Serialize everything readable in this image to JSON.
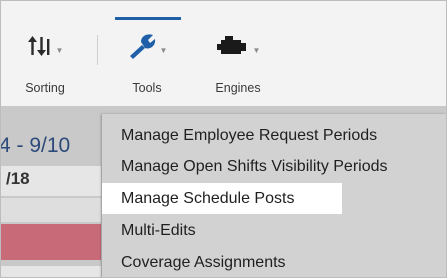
{
  "toolbar": {
    "items": [
      {
        "label": "Sorting",
        "icon": "sorting-icon"
      },
      {
        "label": "Tools",
        "icon": "wrench-icon",
        "active": true
      },
      {
        "label": "Engines",
        "icon": "engine-icon"
      }
    ],
    "accent_color": "#1f5fa8"
  },
  "grid": {
    "date_range": "4 - 9/10",
    "date_label": "/18"
  },
  "menu": {
    "items": [
      {
        "label": "Manage Employee Request Periods"
      },
      {
        "label": "Manage Open Shifts Visibility Periods"
      },
      {
        "label": "Manage Schedule Posts",
        "highlighted": true
      },
      {
        "label": "Multi-Edits"
      },
      {
        "label": "Coverage Assignments"
      }
    ]
  }
}
